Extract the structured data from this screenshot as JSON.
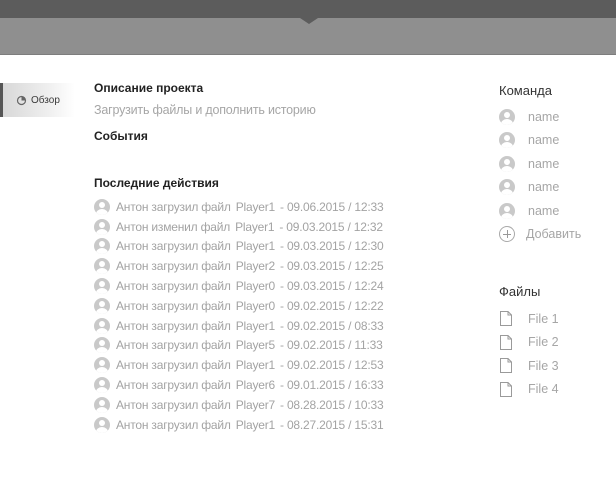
{
  "nav": {
    "overview_label": "Обзор"
  },
  "project": {
    "description_title": "Описание проекта",
    "description_placeholder": "Загрузить файлы и дополнить историю",
    "events_title": "События",
    "activity_title": "Последние действия"
  },
  "activity": [
    {
      "text": "Антон загрузил файл",
      "player": "Player1",
      "date": "- 09.06.2015 / 12:33"
    },
    {
      "text": "Антон изменил файл",
      "player": "Player1",
      "date": "- 09.03.2015 / 12:32"
    },
    {
      "text": "Антон загрузил файл",
      "player": "Player1",
      "date": "- 09.03.2015 / 12:30"
    },
    {
      "text": "Антон загрузил файл",
      "player": "Player2",
      "date": "- 09.03.2015 / 12:25"
    },
    {
      "text": "Антон загрузил файл",
      "player": "Player0",
      "date": "- 09.03.2015 / 12:24"
    },
    {
      "text": "Антон загрузил файл",
      "player": "Player0",
      "date": "- 09.02.2015 / 12:22"
    },
    {
      "text": "Антон загрузил файл",
      "player": "Player1",
      "date": "- 09.02.2015 / 08:33"
    },
    {
      "text": "Антон загрузил файл",
      "player": "Player5",
      "date": "- 09.02.2015 / 11:33"
    },
    {
      "text": "Антон загрузил файл",
      "player": "Player1",
      "date": "- 09.02.2015 / 12:53"
    },
    {
      "text": "Антон загрузил файл",
      "player": "Player6",
      "date": "- 09.01.2015 / 16:33"
    },
    {
      "text": "Антон загрузил файл",
      "player": "Player7",
      "date": "- 08.28.2015 / 10:33"
    },
    {
      "text": "Антон загрузил файл",
      "player": "Player1",
      "date": "- 08.27.2015 / 15:31"
    }
  ],
  "team": {
    "title": "Команда",
    "members": [
      "name",
      "name",
      "name",
      "name",
      "name"
    ],
    "add_label": "Добавить"
  },
  "files": {
    "title": "Файлы",
    "items": [
      "File 1",
      "File 2",
      "File 3",
      "File 4"
    ]
  }
}
